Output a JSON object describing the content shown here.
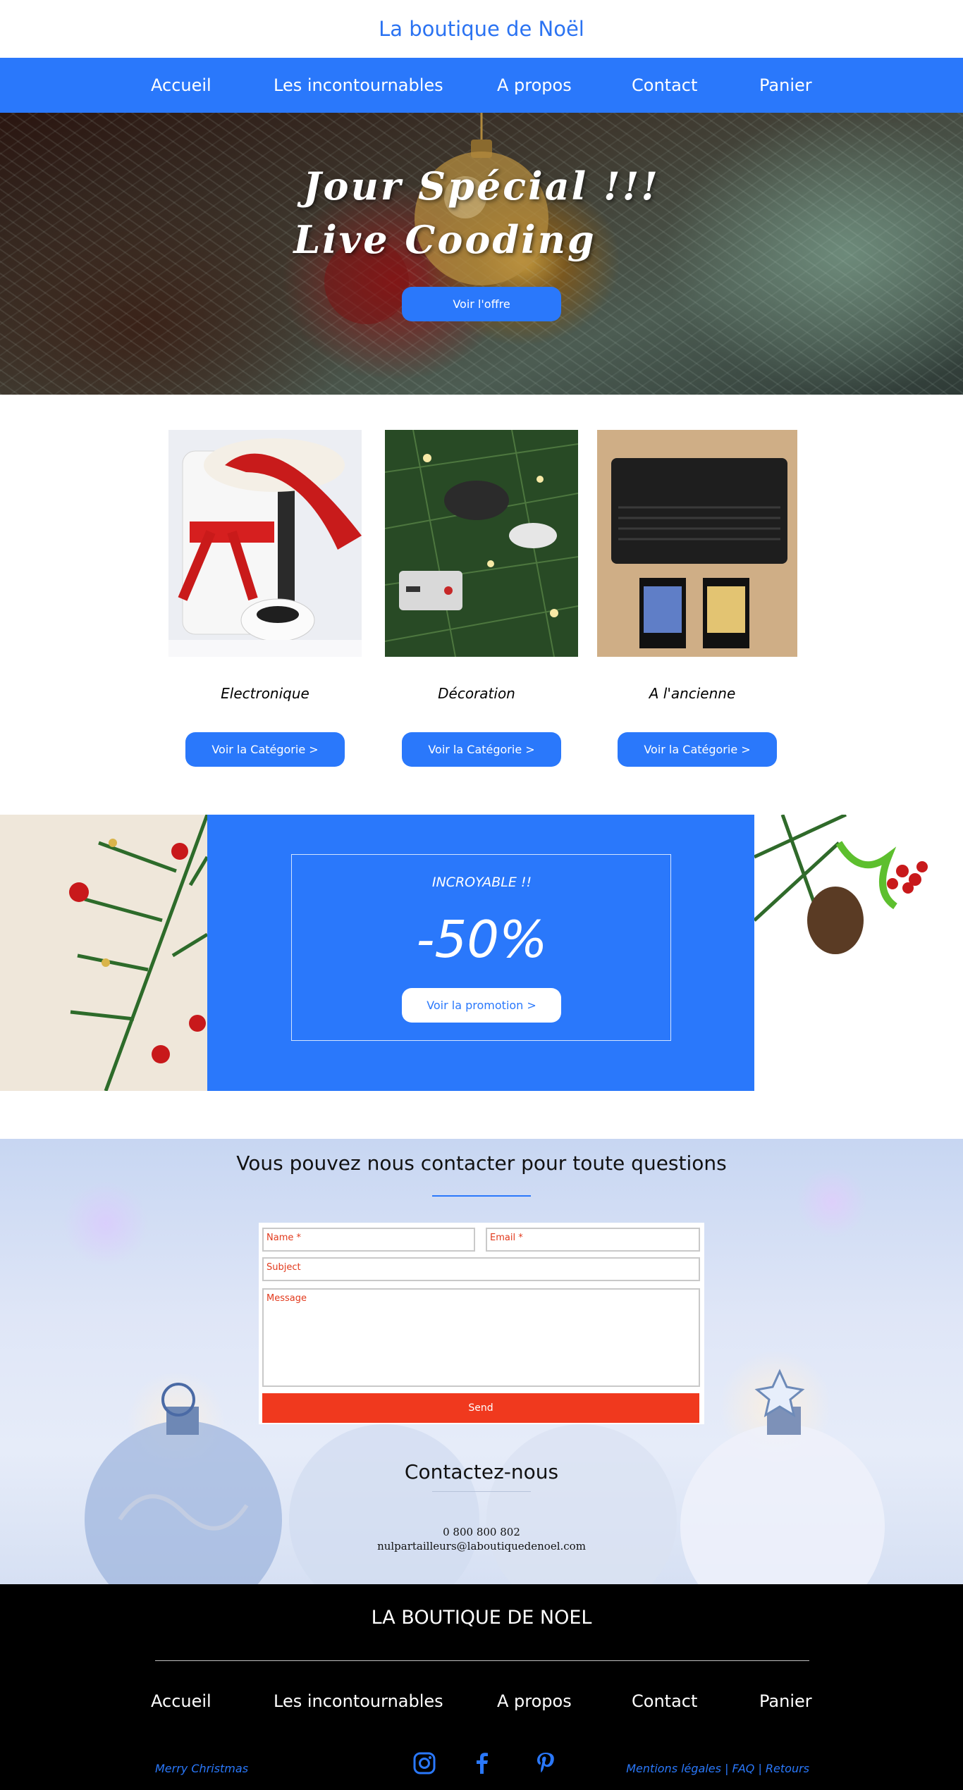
{
  "header": {
    "title": "La boutique de Noël",
    "nav": [
      "Accueil",
      "Les incontournables",
      "A propos",
      "Contact",
      "Panier"
    ]
  },
  "hero": {
    "line1": "Jour  Spécial  !!!",
    "line2": "Live  Cooding",
    "button": "Voir l'offre"
  },
  "categories": [
    {
      "label": "Electronique",
      "button": "Voir la Catégorie >"
    },
    {
      "label": "Décoration",
      "button": "Voir la Catégorie >"
    },
    {
      "label": "A l'ancienne",
      "button": "Voir la Catégorie >"
    }
  ],
  "promo": {
    "kicker": "INCROYABLE !!",
    "discount": "-50%",
    "button": "Voir la promotion >"
  },
  "contact": {
    "heading": "Vous pouvez nous contacter pour toute questions",
    "form": {
      "name_placeholder": "Name *",
      "email_placeholder": "Email *",
      "subject_placeholder": "Subject",
      "message_placeholder": "Message",
      "send": "Send"
    },
    "subheading": "Contactez-nous",
    "phone": "0 800 800 802",
    "email": "nulpartailleurs@laboutiquedenoel.com"
  },
  "footer": {
    "title": "LA BOUTIQUE DE NOEL",
    "nav": [
      "Accueil",
      "Les incontournables",
      "A propos",
      "Contact",
      "Panier"
    ],
    "left_text": "Merry Christmas",
    "right_text": "Mentions légales | FAQ | Retours",
    "social_icons": [
      "instagram-icon",
      "facebook-icon",
      "pinterest-icon"
    ]
  },
  "colors": {
    "accent": "#2a78fb",
    "send_button": "#f0391e",
    "footer_bg": "#000000"
  }
}
